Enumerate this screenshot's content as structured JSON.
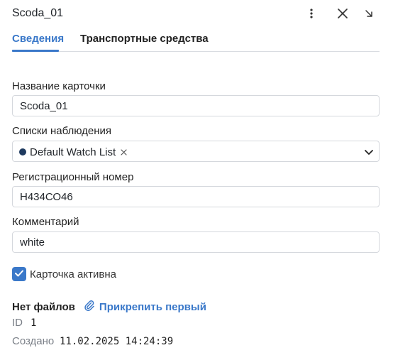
{
  "header": {
    "title": "Scoda_01",
    "more_icon": "more-vertical-icon",
    "close_icon": "close-icon",
    "collapse_icon": "arrow-down-right-icon"
  },
  "tabs": [
    {
      "label": "Сведения",
      "active": true
    },
    {
      "label": "Транспортные средства",
      "active": false
    }
  ],
  "form": {
    "card_name": {
      "label": "Название карточки",
      "value": "Scoda_01"
    },
    "watch_lists": {
      "label": "Списки наблюдения",
      "chip_label": "Default Watch List",
      "chip_color": "#1e3a5f"
    },
    "reg_number": {
      "label": "Регистрационный номер",
      "value": "Н434СО46"
    },
    "comment": {
      "label": "Комментарий",
      "value": "white"
    },
    "active": {
      "label": "Карточка активна",
      "checked": true
    }
  },
  "files": {
    "empty_label": "Нет файлов",
    "attach_label": "Прикрепить первый",
    "attach_icon": "paperclip-icon"
  },
  "meta": {
    "id_label": "ID",
    "id_value": "1",
    "created_label": "Создано",
    "created_value": "11.02.2025 14:24:39"
  },
  "colors": {
    "accent": "#3a78c9",
    "chip_dot": "#1e3a5f",
    "border": "#d5d8dd"
  }
}
